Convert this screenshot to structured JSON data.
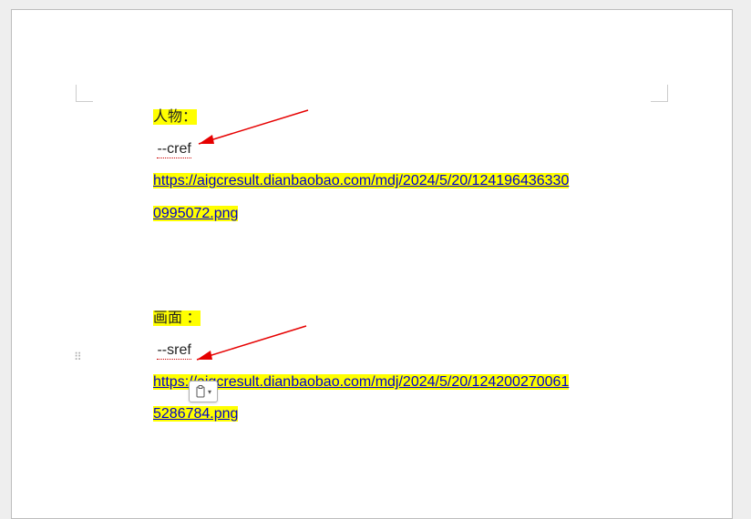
{
  "section1": {
    "heading": "人物：",
    "flag": "--cref",
    "url_line1": "https://aigcresult.dianbaobao.com/mdj/2024/5/20/124196436330",
    "url_line2": "0995072.png"
  },
  "section2": {
    "heading": "画面 ：",
    "flag": "--sref",
    "url_line1": "https://aigcresult.dianbaobao.com/mdj/2024/5/20/124200270061",
    "url_line2": "5286784.png"
  },
  "paste_options": {
    "icon": "clipboard-icon"
  }
}
